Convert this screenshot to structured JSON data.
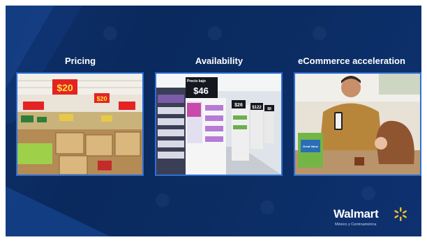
{
  "columns": [
    {
      "title": "Pricing",
      "image": "grocery-store-price-signs-photo"
    },
    {
      "title": "Availability",
      "image": "store-aisle-shelves-photo"
    },
    {
      "title": "eCommerce acceleration",
      "image": "man-showing-phone-to-child-photo"
    }
  ],
  "signs": {
    "price_large": "$20",
    "price_medium": "$20",
    "aisle_main": "$46",
    "aisle_2": "$26",
    "aisle_3": "$122",
    "aisle_4": "$8",
    "aisle_header": "Precio bajo",
    "product_card": "Great Value"
  },
  "logo": {
    "word": "Walmart",
    "sub": "México y Centroamérica",
    "spark_color": "#ffc220"
  },
  "colors": {
    "background": "#0b2c62",
    "frame": "#2f6fd6",
    "title_text": "#ffffff"
  }
}
